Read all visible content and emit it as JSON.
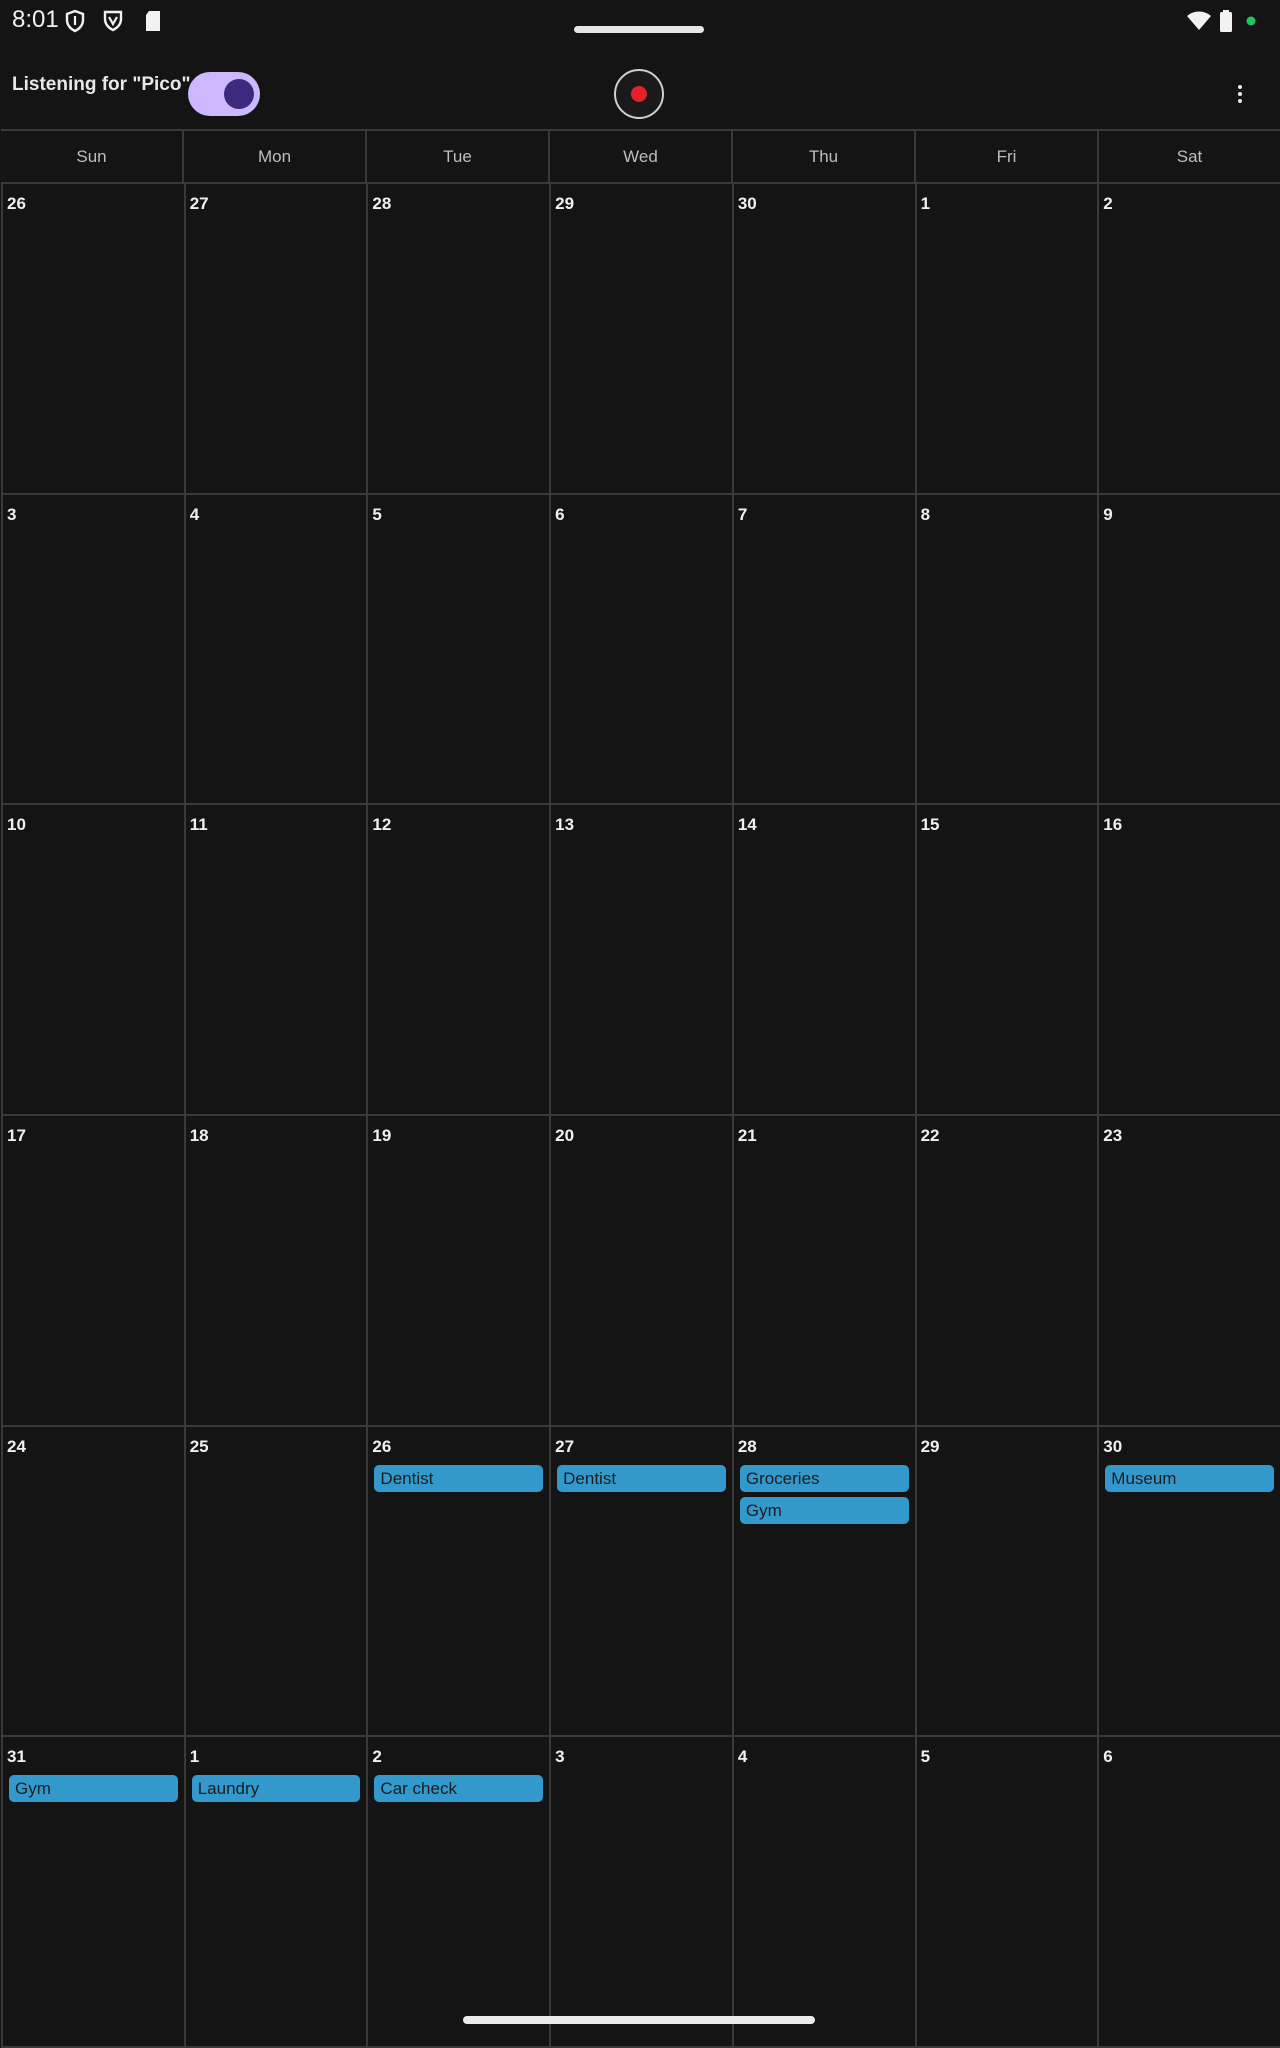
{
  "status_bar": {
    "time": "8:01",
    "left_icons": [
      "shield-icon",
      "shield-v-icon",
      "sd-card-icon"
    ],
    "right_icons": [
      "wifi-icon",
      "battery-icon",
      "privacy-dot-icon"
    ],
    "privacy_dot_color": "#22c55e"
  },
  "toolbar": {
    "listening_label": "Listening for \"Pico\"",
    "listening_enabled": true,
    "toggle_track_color": "#cdb8ff",
    "toggle_knob_color": "#3b2a7d",
    "record_icon": "record-icon",
    "record_color": "#e5202a",
    "more_icon": "more-vert-icon"
  },
  "calendar": {
    "weekdays": [
      "Sun",
      "Mon",
      "Tue",
      "Wed",
      "Thu",
      "Fri",
      "Sat"
    ],
    "event_color": "#3399cc",
    "weeks": [
      [
        {
          "day": "26",
          "events": []
        },
        {
          "day": "27",
          "events": []
        },
        {
          "day": "28",
          "events": []
        },
        {
          "day": "29",
          "events": []
        },
        {
          "day": "30",
          "events": []
        },
        {
          "day": "1",
          "events": []
        },
        {
          "day": "2",
          "events": []
        }
      ],
      [
        {
          "day": "3",
          "events": []
        },
        {
          "day": "4",
          "events": []
        },
        {
          "day": "5",
          "events": []
        },
        {
          "day": "6",
          "events": []
        },
        {
          "day": "7",
          "events": []
        },
        {
          "day": "8",
          "events": []
        },
        {
          "day": "9",
          "events": []
        }
      ],
      [
        {
          "day": "10",
          "events": []
        },
        {
          "day": "11",
          "events": []
        },
        {
          "day": "12",
          "events": []
        },
        {
          "day": "13",
          "events": []
        },
        {
          "day": "14",
          "events": []
        },
        {
          "day": "15",
          "events": []
        },
        {
          "day": "16",
          "events": []
        }
      ],
      [
        {
          "day": "17",
          "events": []
        },
        {
          "day": "18",
          "events": []
        },
        {
          "day": "19",
          "events": []
        },
        {
          "day": "20",
          "events": []
        },
        {
          "day": "21",
          "events": []
        },
        {
          "day": "22",
          "events": []
        },
        {
          "day": "23",
          "events": []
        }
      ],
      [
        {
          "day": "24",
          "events": []
        },
        {
          "day": "25",
          "events": []
        },
        {
          "day": "26",
          "events": [
            "Dentist"
          ]
        },
        {
          "day": "27",
          "events": [
            "Dentist"
          ]
        },
        {
          "day": "28",
          "events": [
            "Groceries",
            "Gym"
          ]
        },
        {
          "day": "29",
          "events": []
        },
        {
          "day": "30",
          "events": [
            "Museum"
          ]
        }
      ],
      [
        {
          "day": "31",
          "events": [
            "Gym"
          ]
        },
        {
          "day": "1",
          "events": [
            "Laundry"
          ]
        },
        {
          "day": "2",
          "events": [
            "Car check"
          ]
        },
        {
          "day": "3",
          "events": []
        },
        {
          "day": "4",
          "events": []
        },
        {
          "day": "5",
          "events": []
        },
        {
          "day": "6",
          "events": []
        }
      ]
    ]
  }
}
